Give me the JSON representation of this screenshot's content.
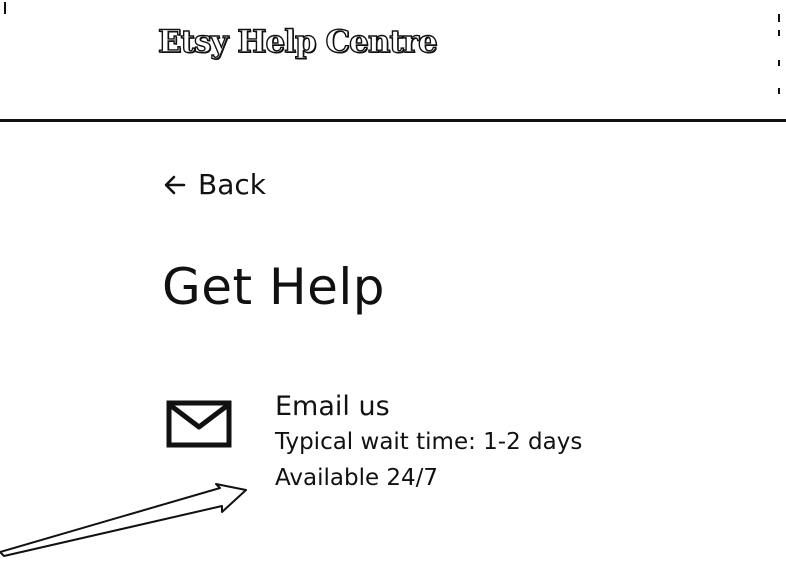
{
  "header": {
    "logo_text": "Etsy Help Centre"
  },
  "nav": {
    "back_label": "Back",
    "back_icon": "arrow-left-icon"
  },
  "main": {
    "title": "Get Help",
    "options": [
      {
        "icon": "envelope-icon",
        "title": "Email us",
        "wait_time": "Typical wait time: 1-2 days",
        "availability": "Available 24/7"
      }
    ]
  },
  "colors": {
    "text": "#111111",
    "background": "#ffffff"
  }
}
